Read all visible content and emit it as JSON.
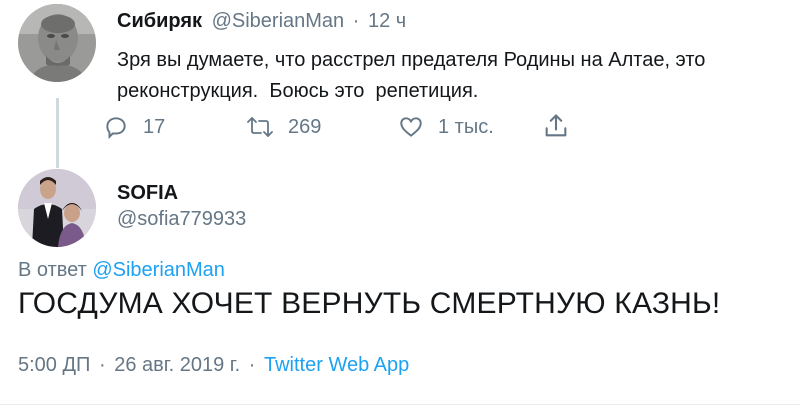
{
  "tweet": {
    "author_name": "Сибиряк",
    "author_handle": "@SiberianMan",
    "separator": "·",
    "time_ago": "12 ч",
    "text_line1": "Зря вы думаете, что расстрел предателя Родины на Алтае, это",
    "text_line2": "реконструкция.  Боюсь это  репетиция.",
    "stats": {
      "replies": "17",
      "retweets": "269",
      "likes": "1 тыс."
    }
  },
  "reply": {
    "author_name": "SOFIA",
    "author_handle": "@sofia779933",
    "in_reply_prefix": "В ответ",
    "in_reply_handle": "@SiberianMan",
    "text": "ГОСДУМА ХОЧЕТ ВЕРНУТЬ СМЕРТНУЮ КАЗНЬ!",
    "time": "5:00 ДП",
    "date": "26 авг. 2019 г.",
    "separator1": "·",
    "separator2": "·",
    "source": "Twitter Web App"
  },
  "icons": {
    "reply": "speech-bubble-icon",
    "retweet": "retweet-icon",
    "like": "heart-icon",
    "share": "share-icon"
  },
  "colors": {
    "link": "#1da1f2",
    "muted": "#657786",
    "text": "#14171a"
  }
}
